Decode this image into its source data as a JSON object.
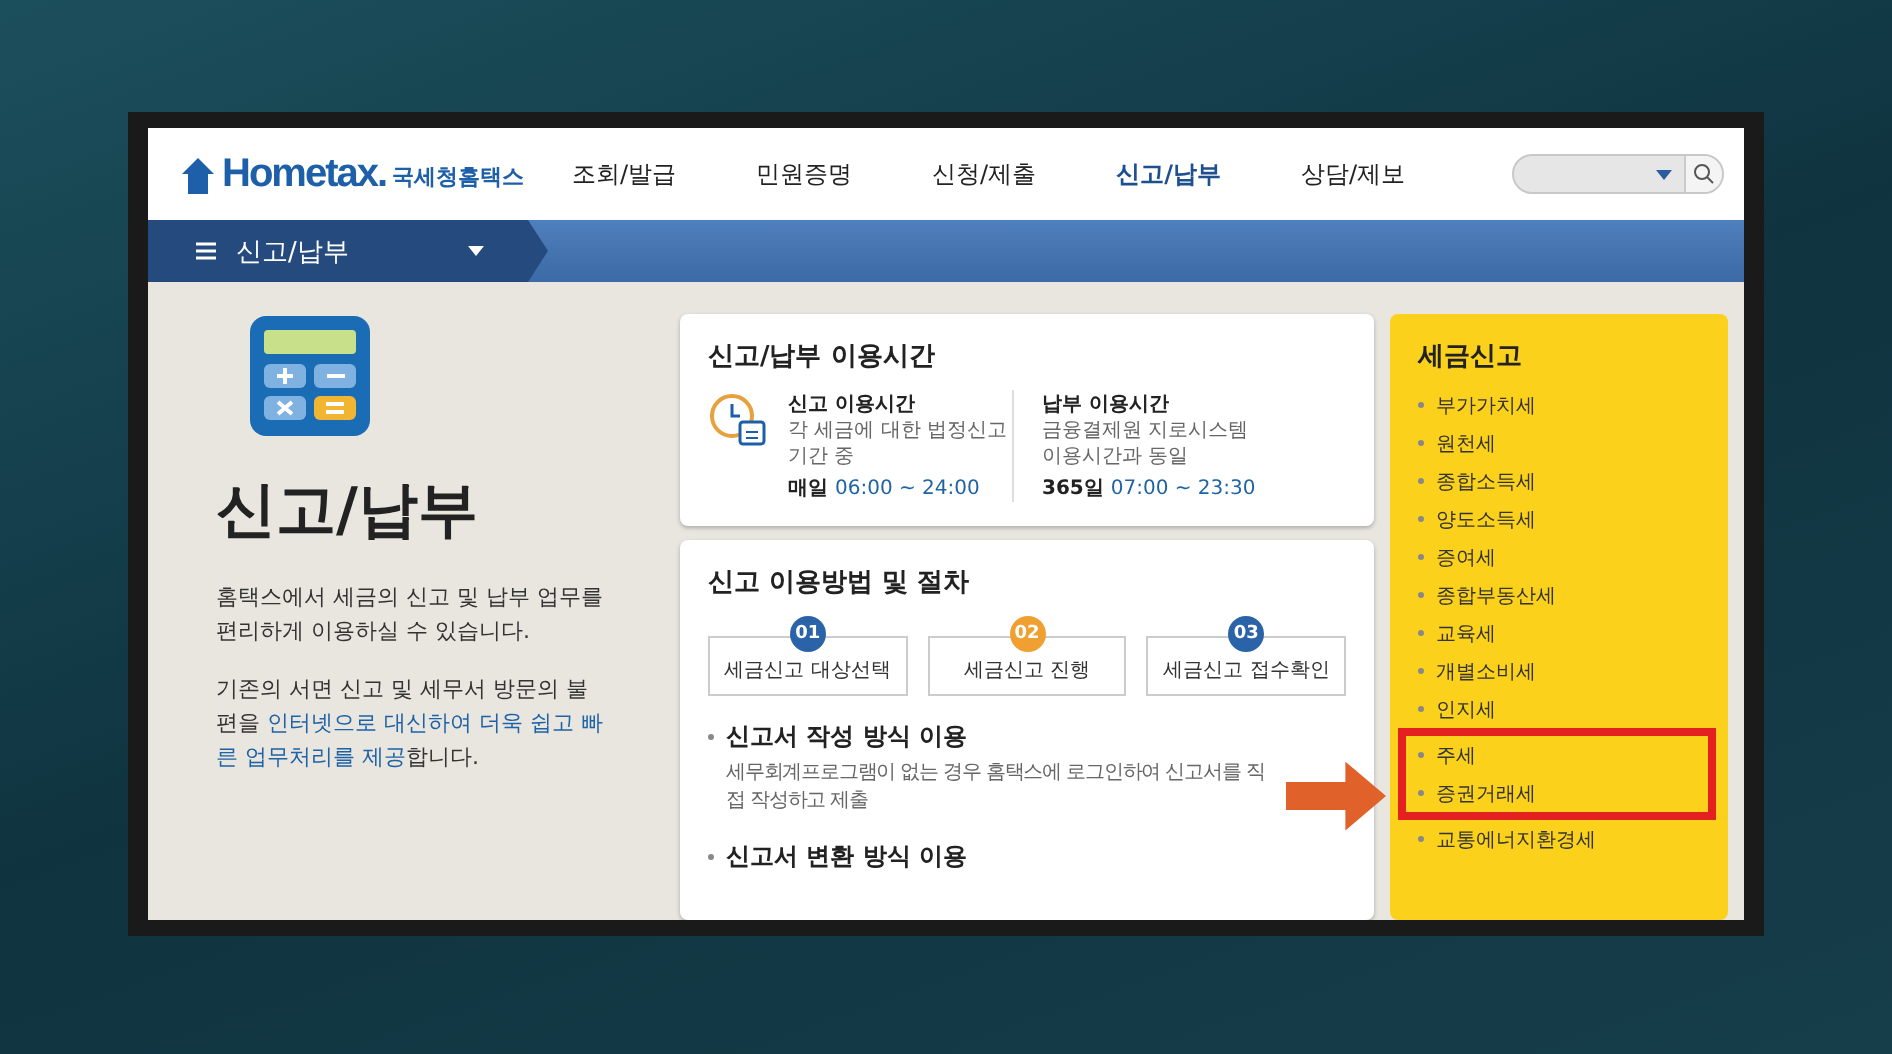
{
  "header": {
    "logo": {
      "brand": "Hometax.",
      "name": "국세청홈택스"
    },
    "nav": [
      {
        "label": "조회/발급",
        "selected": false
      },
      {
        "label": "민원증명",
        "selected": false
      },
      {
        "label": "신청/제출",
        "selected": false
      },
      {
        "label": "신고/납부",
        "selected": true
      },
      {
        "label": "상담/제보",
        "selected": false
      }
    ]
  },
  "breadcrumb": {
    "label": "신고/납부"
  },
  "intro": {
    "title": "신고/납부",
    "paragraphs": [
      [
        {
          "text": "홈택스에서 세금의 신고 및 납부 업무를 편리하게 이용하실 수 있습니다.",
          "highlight": false
        }
      ],
      [
        {
          "text": "기존의 서면 신고 및 세무서 방문의 불편을 ",
          "highlight": false
        },
        {
          "text": "인터넷으로 대신하여 더욱 쉽고 빠른 업무처리를 제공",
          "highlight": true
        },
        {
          "text": "합니다.",
          "highlight": false
        }
      ]
    ]
  },
  "hours": {
    "title": "신고/납부 이용시간",
    "items": [
      {
        "title": "신고 이용시간",
        "lines": [
          "각 세금에 대한 법정신고",
          "기간 중"
        ],
        "day": "매일",
        "time": "06:00 ~ 24:00"
      },
      {
        "title": "납부 이용시간",
        "lines": [
          "금융결제원 지로시스템",
          "이용시간과 동일"
        ],
        "day": "365일",
        "time": "07:00 ~ 23:30"
      }
    ]
  },
  "procedure": {
    "title": "신고 이용방법 및 절차",
    "steps": [
      {
        "number": "01",
        "label": "세금신고 대상선택",
        "color": "#2a63a8"
      },
      {
        "number": "02",
        "label": "세금신고 진행",
        "color": "#f0a030"
      },
      {
        "number": "03",
        "label": "세금신고 접수확인",
        "color": "#2a63a8"
      }
    ],
    "methods": [
      {
        "title": "신고서 작성 방식 이용",
        "desc": "세무회계프로그램이 없는 경우 홈택스에 로그인하여 신고서를 직접 작성하고 제출"
      },
      {
        "title": "신고서 변환 방식 이용"
      }
    ]
  },
  "sidebar": {
    "title": "세금신고",
    "items": [
      {
        "label": "부가가치세",
        "highlighted": false
      },
      {
        "label": "원천세",
        "highlighted": false
      },
      {
        "label": "종합소득세",
        "highlighted": false
      },
      {
        "label": "양도소득세",
        "highlighted": false
      },
      {
        "label": "증여세",
        "highlighted": false
      },
      {
        "label": "종합부동산세",
        "highlighted": false
      },
      {
        "label": "교육세",
        "highlighted": false
      },
      {
        "label": "개별소비세",
        "highlighted": false
      },
      {
        "label": "인지세",
        "highlighted": false
      },
      {
        "label": "주세",
        "highlighted": true
      },
      {
        "label": "증권거래세",
        "highlighted": true
      },
      {
        "label": "교통에너지환경세",
        "highlighted": false
      }
    ]
  },
  "annotation": {
    "arrow": true
  }
}
